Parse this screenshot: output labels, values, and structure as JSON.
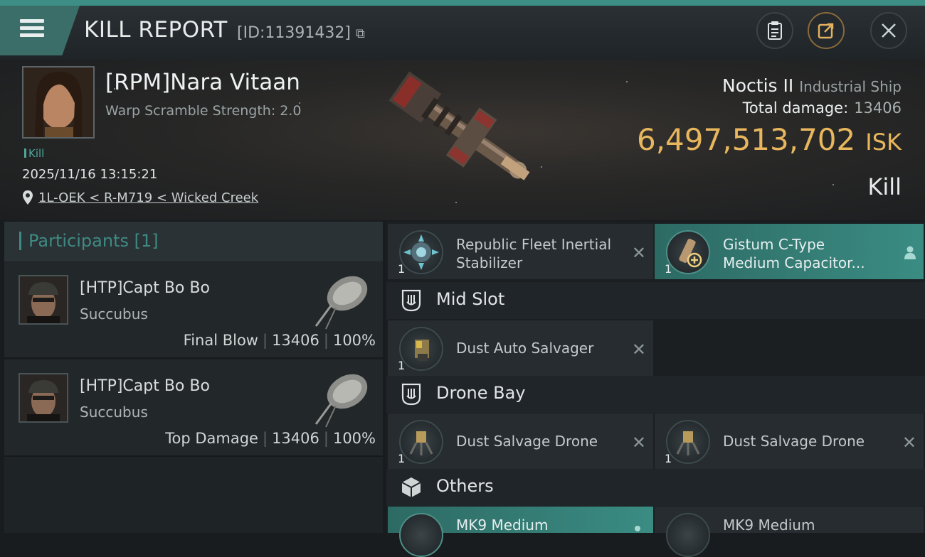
{
  "header": {
    "title": "KILL REPORT",
    "report_id": "[ID:11391432]",
    "buttons": [
      "clipboard-icon",
      "share-icon",
      "close-icon"
    ]
  },
  "victim": {
    "name": "[RPM]Nara Vitaan",
    "warp_scramble": "Warp Scramble Strength: 2.0",
    "kill_tag": "Kill",
    "datetime": "2025/11/16 13:15:21",
    "location": "1L-OEK < R-M719 < Wicked Creek"
  },
  "ship": {
    "name": "Noctis II",
    "class": "Industrial Ship",
    "total_damage_label": "Total damage:",
    "total_damage": "13406",
    "value": "6,497,513,702",
    "value_unit": "ISK",
    "result": "Kill"
  },
  "participants": {
    "title": "Participants",
    "count": "[1]",
    "rows": [
      {
        "name": "[HTP]Capt Bo Bo",
        "ship": "Succubus",
        "role": "Final Blow",
        "damage": "13406",
        "percent": "100%"
      },
      {
        "name": "[HTP]Capt Bo Bo",
        "ship": "Succubus",
        "role": "Top Damage",
        "damage": "13406",
        "percent": "100%"
      }
    ]
  },
  "fitting": {
    "low_items": [
      {
        "qty": "1",
        "line1": "Republic Fleet Inertial",
        "line2": "Stabilizer"
      },
      {
        "qty": "1",
        "line1": "Gistum C-Type",
        "line2": "Medium Capacitor..."
      }
    ],
    "mid_label": "Mid Slot",
    "mid_items": [
      {
        "qty": "1",
        "name": "Dust Auto Salvager"
      }
    ],
    "drone_label": "Drone Bay",
    "drone_items": [
      {
        "qty": "1",
        "name": "Dust Salvage Drone"
      },
      {
        "qty": "1",
        "name": "Dust Salvage Drone"
      }
    ],
    "others_label": "Others",
    "other_items": [
      {
        "name": "MK9 Medium"
      },
      {
        "name": "MK9 Medium"
      }
    ]
  },
  "colors": {
    "accent": "#3d8f86",
    "isk": "#e7b65d"
  }
}
